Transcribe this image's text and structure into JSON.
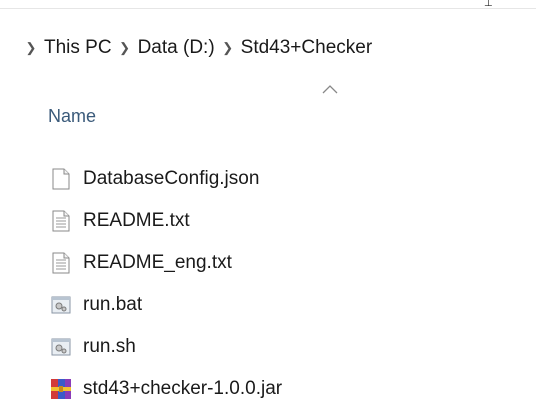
{
  "breadcrumb": {
    "items": [
      "This PC",
      "Data (D:)",
      "Std43+Checker"
    ]
  },
  "columns": {
    "name_header": "Name"
  },
  "files": [
    {
      "name": "DatabaseConfig.json",
      "icon": "blank-file-icon"
    },
    {
      "name": "README.txt",
      "icon": "text-file-icon"
    },
    {
      "name": "README_eng.txt",
      "icon": "text-file-icon"
    },
    {
      "name": "run.bat",
      "icon": "batch-file-icon"
    },
    {
      "name": "run.sh",
      "icon": "batch-file-icon"
    },
    {
      "name": "std43+checker-1.0.0.jar",
      "icon": "archive-icon"
    }
  ],
  "colors": {
    "header_text": "#3a5a7a",
    "archive_red": "#d23a3a",
    "archive_blue": "#3b5bc8",
    "archive_yellow": "#f2c230"
  }
}
